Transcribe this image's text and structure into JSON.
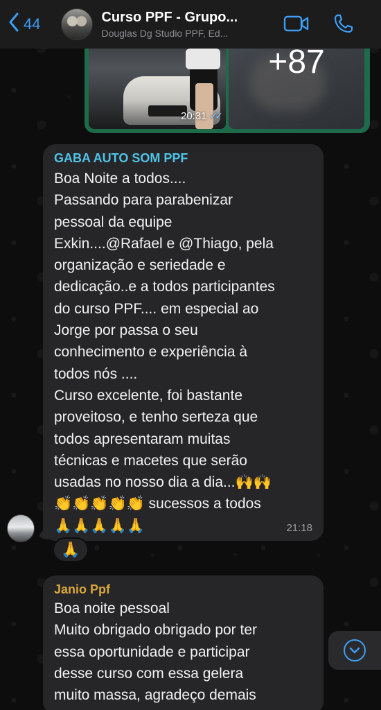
{
  "header": {
    "back_count": "44",
    "title": "Curso PPF - Grupo...",
    "subtitle": "Douglas Dg Studio PPF, Ed..."
  },
  "media": {
    "time": "20:31",
    "more_count": "+87"
  },
  "message1": {
    "sender": "GABA AUTO SOM PPF",
    "sender_color": "#4fc3e8",
    "lines": [
      "Boa Noite a todos....",
      "Passando para parabenizar",
      "pessoal da equipe",
      "Exkin....@Rafael  e @Thiago, pela",
      "organização e seriedade e",
      "dedicação..e a  todos participantes",
      "do curso PPF.... em especial ao",
      "Jorge  por passa o seu",
      "conhecimento e experiência à",
      "todos nós ....",
      "Curso excelente,  foi bastante",
      "proveitoso,  e tenho serteza que",
      "todos apresentaram muitas",
      "técnicas e macetes que serão",
      "usadas no nosso dia a dia...🙌🙌"
    ],
    "line_clap": "👏👏👏👏👏 sucessos a todos",
    "line_pray": "🙏🙏🙏🙏🙏",
    "time": "21:18",
    "reaction": "🙏"
  },
  "message2": {
    "sender": "Janio Ppf",
    "sender_color": "#d9a73a",
    "lines": [
      "Boa noite pessoal",
      "Muito obrigado obrigado por ter",
      "essa oportunidade e participar",
      "desse curso com essa gelera",
      "muito massa, agradeço demais"
    ]
  },
  "colors": {
    "accent": "#3d9ef5",
    "bubble": "#262628",
    "media_bubble": "#1d6b4a"
  },
  "icons": {
    "back": "chevron-left-icon",
    "video": "video-call-icon",
    "phone": "phone-icon",
    "scroll": "chevron-down-icon"
  }
}
